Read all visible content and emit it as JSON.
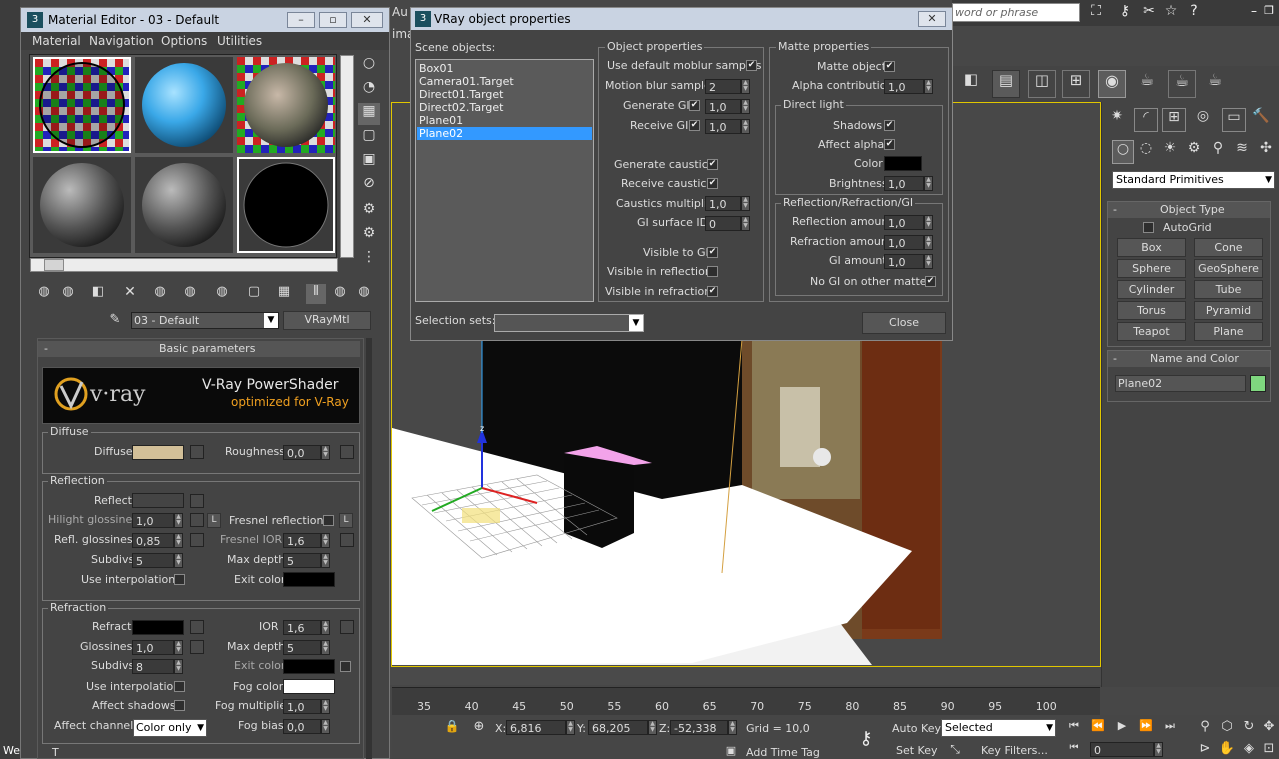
{
  "top_bar": {
    "search_placeholder": "word or phrase",
    "im_text": "ima",
    "au_text": "Au"
  },
  "material_editor": {
    "title": "Material Editor - 03 - Default",
    "menu": [
      "Material",
      "Navigation",
      "Options",
      "Utilities"
    ],
    "material_name": "03 - Default",
    "material_type": "VRayMtl",
    "rollout_title": "Basic parameters",
    "banner_line1": "V-Ray PowerShader",
    "banner_line2": "optimized for V-Ray",
    "banner_logo": "v·ray",
    "diffuse": {
      "group": "Diffuse",
      "label": "Diffuse",
      "color": "#d2bf98",
      "roughness_label": "Roughness",
      "roughness": "0,0"
    },
    "reflection": {
      "group": "Reflection",
      "reflect_label": "Reflect",
      "hilight_label": "Hilight glossiness",
      "hilight": "1,0",
      "lock_label": "L",
      "fresnel_label": "Fresnel reflections",
      "refl_gloss_label": "Refl. glossiness",
      "refl_gloss": "0,85",
      "fresnel_ior_label": "Fresnel IOR",
      "fresnel_ior": "1,6",
      "subdivs_label": "Subdivs",
      "subdivs": "5",
      "max_depth_label": "Max depth",
      "max_depth": "5",
      "interp_label": "Use interpolation",
      "exit_label": "Exit color"
    },
    "refraction": {
      "group": "Refraction",
      "refract_label": "Refract",
      "ior_label": "IOR",
      "ior": "1,6",
      "gloss_label": "Glossiness",
      "gloss": "1,0",
      "max_depth_label": "Max depth",
      "max_depth": "5",
      "subdivs_label": "Subdivs",
      "subdivs": "8",
      "exit_label": "Exit color",
      "interp_label": "Use interpolation",
      "fog_color_label": "Fog color",
      "shadows_label": "Affect shadows",
      "fog_mult_label": "Fog multiplier",
      "fog_mult": "1,0",
      "channels_label": "Affect channels",
      "channels": "Color only",
      "fog_bias_label": "Fog bias",
      "fog_bias": "0,0"
    },
    "bottom_text": "T"
  },
  "vray_dialog": {
    "title": "VRay object properties",
    "scene_objects_label": "Scene objects:",
    "objects": [
      "Box01",
      "Camera01.Target",
      "Direct01.Target",
      "Direct02.Target",
      "Plane01",
      "Plane02"
    ],
    "selected_index": 5,
    "object_properties_group": "Object properties",
    "use_default_moblur": "Use default moblur samples",
    "motion_blur_label": "Motion blur samples",
    "motion_blur": "2",
    "generate_gi_label": "Generate GI",
    "generate_gi": "1,0",
    "receive_gi_label": "Receive GI",
    "receive_gi": "1,0",
    "generate_caustics": "Generate caustics",
    "receive_caustics": "Receive caustics",
    "caustics_mult_label": "Caustics multiplier",
    "caustics_mult": "1,0",
    "gi_surface_label": "GI surface ID",
    "gi_surface": "0",
    "visible_gi": "Visible to GI",
    "visible_refl": "Visible in reflections",
    "visible_refr": "Visible in refractions",
    "matte_group": "Matte properties",
    "matte_object": "Matte object",
    "alpha_contrib_label": "Alpha contribution",
    "alpha_contrib": "1,0",
    "direct_light_group": "Direct light",
    "shadows": "Shadows",
    "affect_alpha": "Affect alpha",
    "color_label": "Color",
    "brightness_label": "Brightness",
    "brightness": "1,0",
    "rrgi_group": "Reflection/Refraction/GI",
    "refl_amount_label": "Reflection amount",
    "refl_amount": "1,0",
    "refr_amount_label": "Refraction amount",
    "refr_amount": "1,0",
    "gi_amount_label": "GI amount",
    "gi_amount": "1,0",
    "no_gi_label": "No GI on other mattes",
    "selection_sets_label": "Selection sets:",
    "close_label": "Close"
  },
  "command_panel": {
    "dropdown": "Standard Primitives",
    "object_type_title": "Object Type",
    "autogrid": "AutoGrid",
    "buttons": [
      "Box",
      "Cone",
      "Sphere",
      "GeoSphere",
      "Cylinder",
      "Tube",
      "Torus",
      "Pyramid",
      "Teapot",
      "Plane"
    ],
    "name_color_title": "Name and Color",
    "object_name": "Plane02",
    "object_color": "#7fd77f"
  },
  "timeline": {
    "ticks": [
      "35",
      "40",
      "45",
      "50",
      "55",
      "60",
      "65",
      "70",
      "75",
      "80",
      "85",
      "90",
      "95",
      "100"
    ]
  },
  "status_bar": {
    "x_label": "X:",
    "x": "6,816",
    "y_label": "Y:",
    "y": "68,205",
    "z_label": "Z:",
    "z": "-52,338",
    "grid": "Grid = 10,0",
    "add_time_tag": "Add Time Tag",
    "auto_key": "Auto Key",
    "selected": "Selected",
    "set_key": "Set Key",
    "key_filters": "Key Filters...",
    "frame": "0",
    "we_text": "We"
  },
  "colors": {
    "accent_selection": "#3399ff",
    "viewport_border": "#e1c700",
    "matte_box_pink": "#f3a3ea"
  }
}
